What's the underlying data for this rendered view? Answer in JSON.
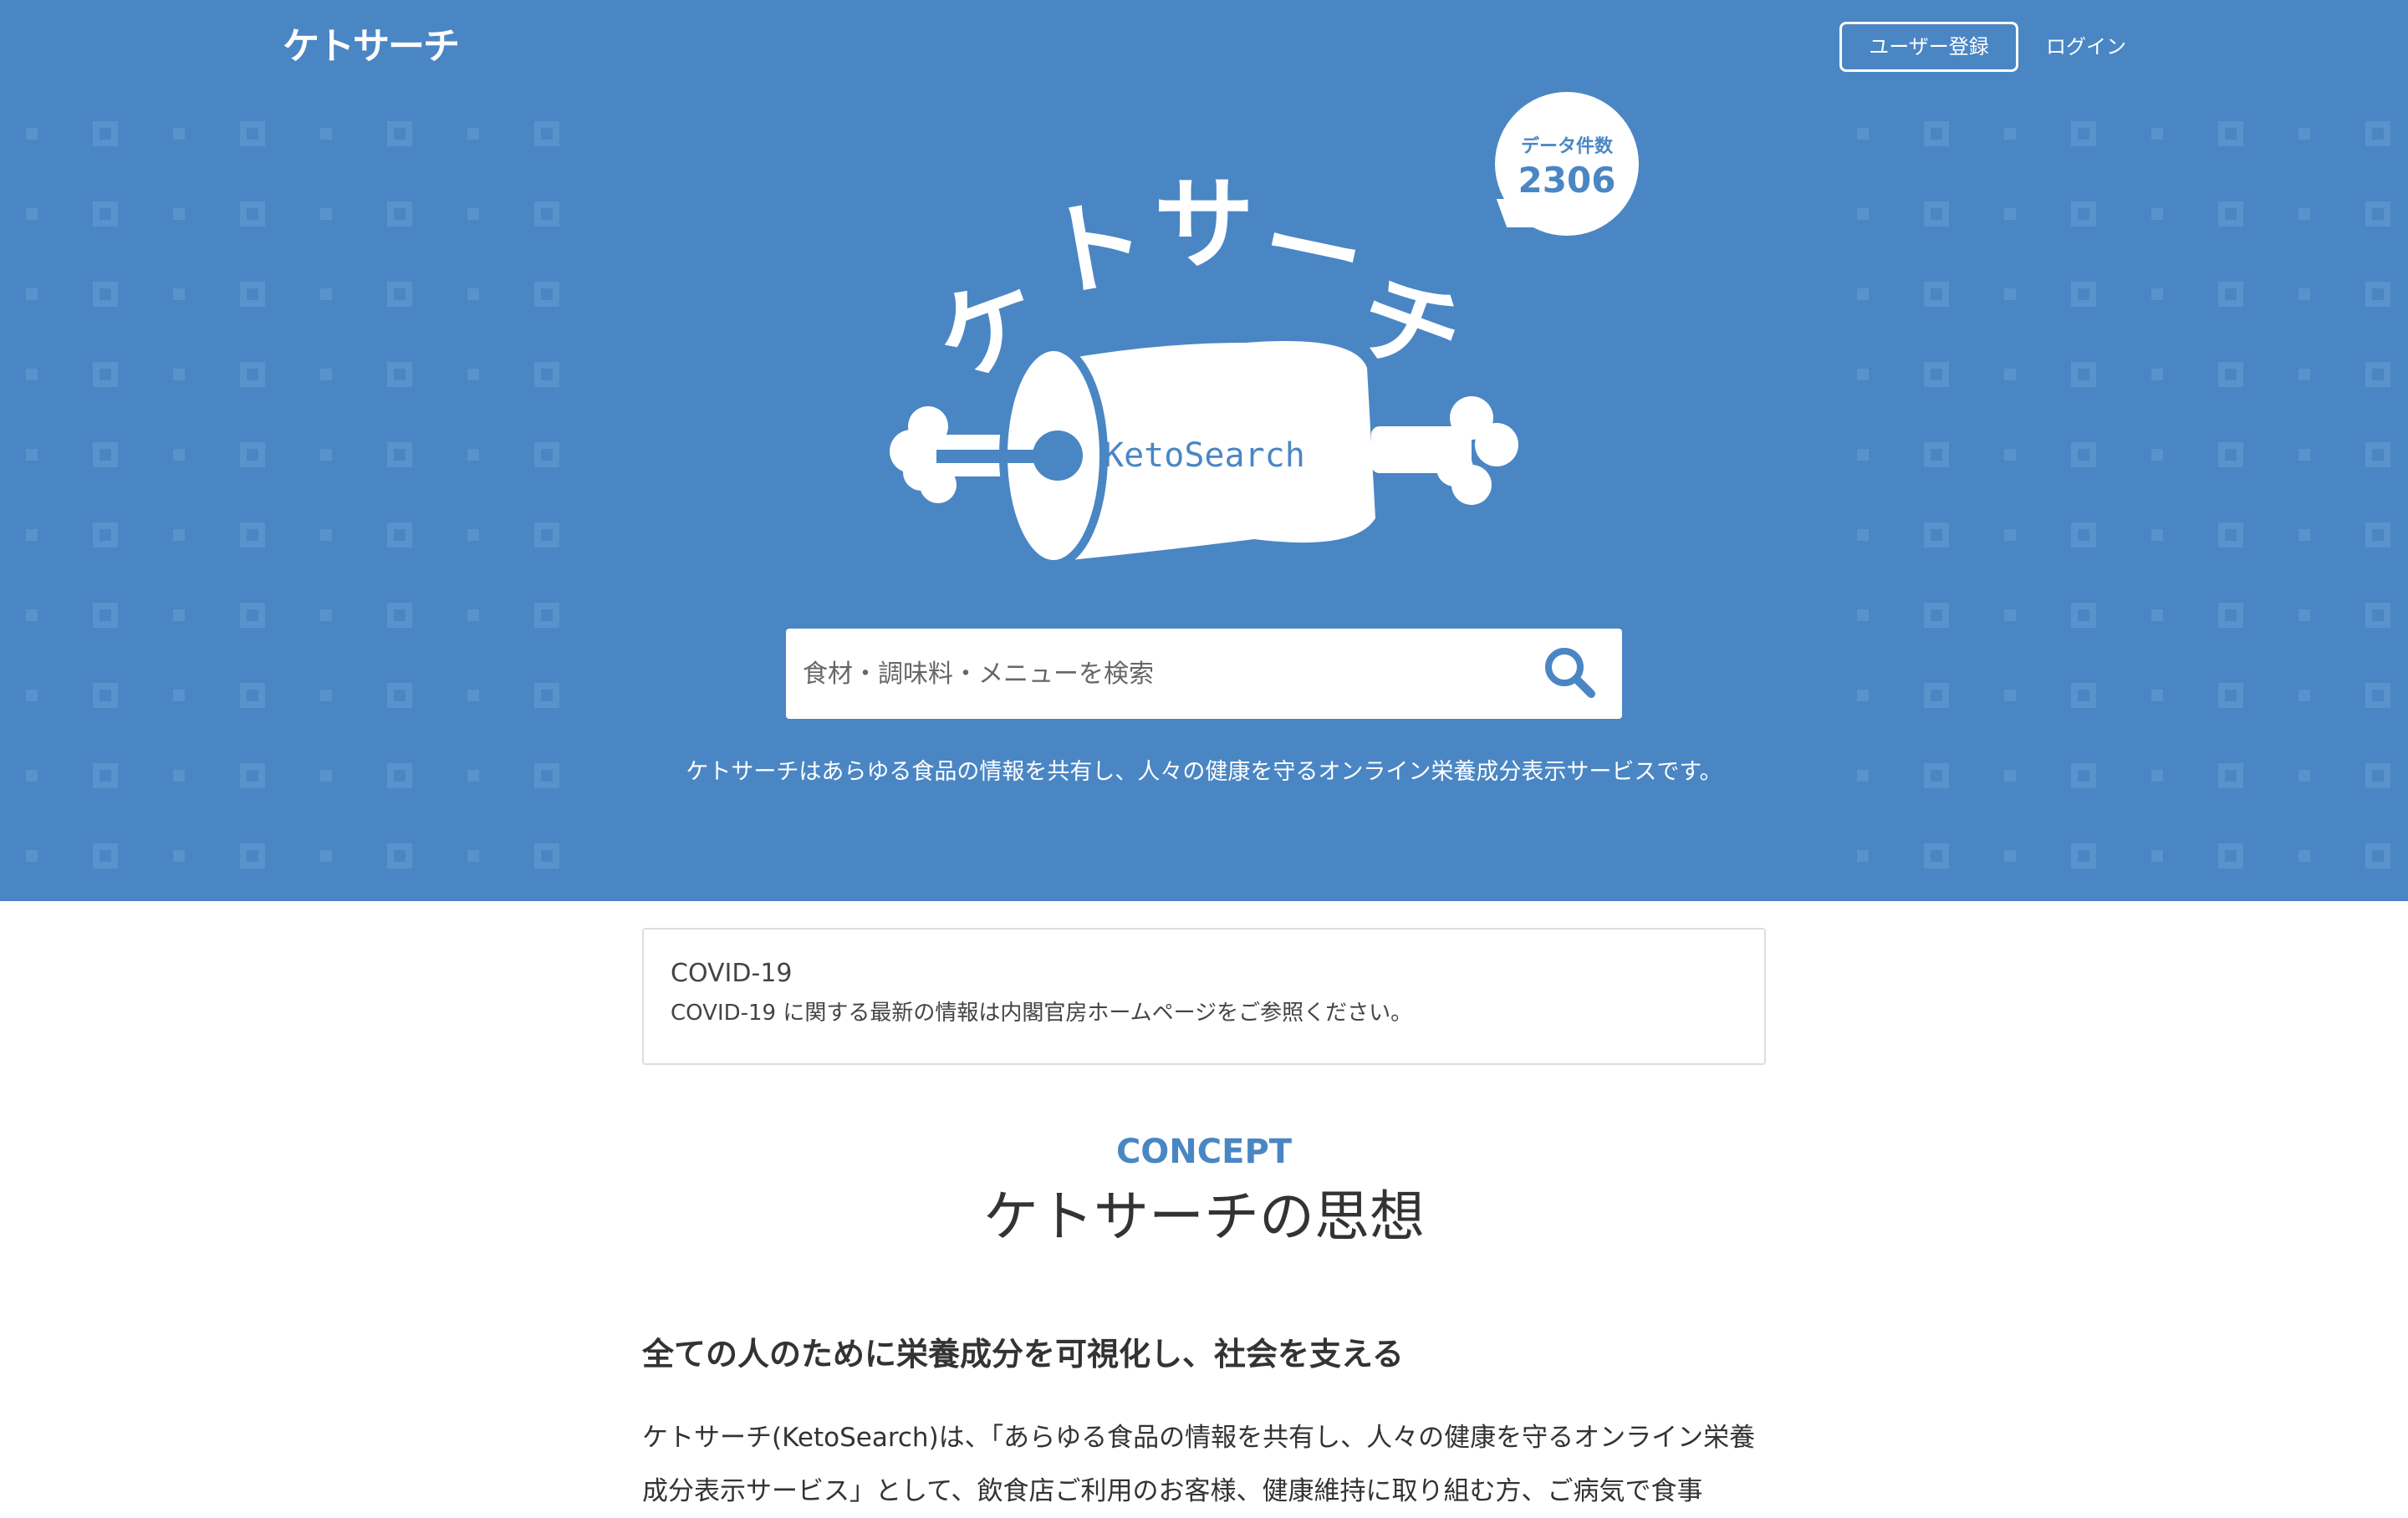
{
  "nav": {
    "logo_text": "ケトサーチ",
    "register_label": "ユーザー登録",
    "login_label": "ログイン"
  },
  "hero": {
    "logo_title": "ケトサーチ",
    "logo_subtitle": "KetoSearch",
    "data_count_label": "データ件数",
    "data_count_value": "2306",
    "search_placeholder": "食材・調味料・メニューを検索",
    "tagline": "ケトサーチはあらゆる食品の情報を共有し、人々の健康を守るオンライン栄養成分表示サービスです。"
  },
  "notice": {
    "title": "COVID-19",
    "body": "COVID-19 に関する最新の情報は内閣官房ホームページをご参照ください。"
  },
  "concept": {
    "label": "CONCEPT",
    "title": "ケトサーチの思想",
    "heading": "全ての人のために栄養成分を可視化し、社会を支える",
    "body": "ケトサーチ(KetoSearch)は、「あらゆる食品の情報を共有し、人々の健康を守るオンライン栄養成分表示サービス」として、飲食店ご利用のお客様、健康維持に取り組む方、ご病気で食事"
  },
  "colors": {
    "brand_blue": "#4a86c4",
    "pattern_blue": "#5a93cc",
    "white": "#ffffff"
  },
  "icons": {
    "search": "search-icon"
  }
}
